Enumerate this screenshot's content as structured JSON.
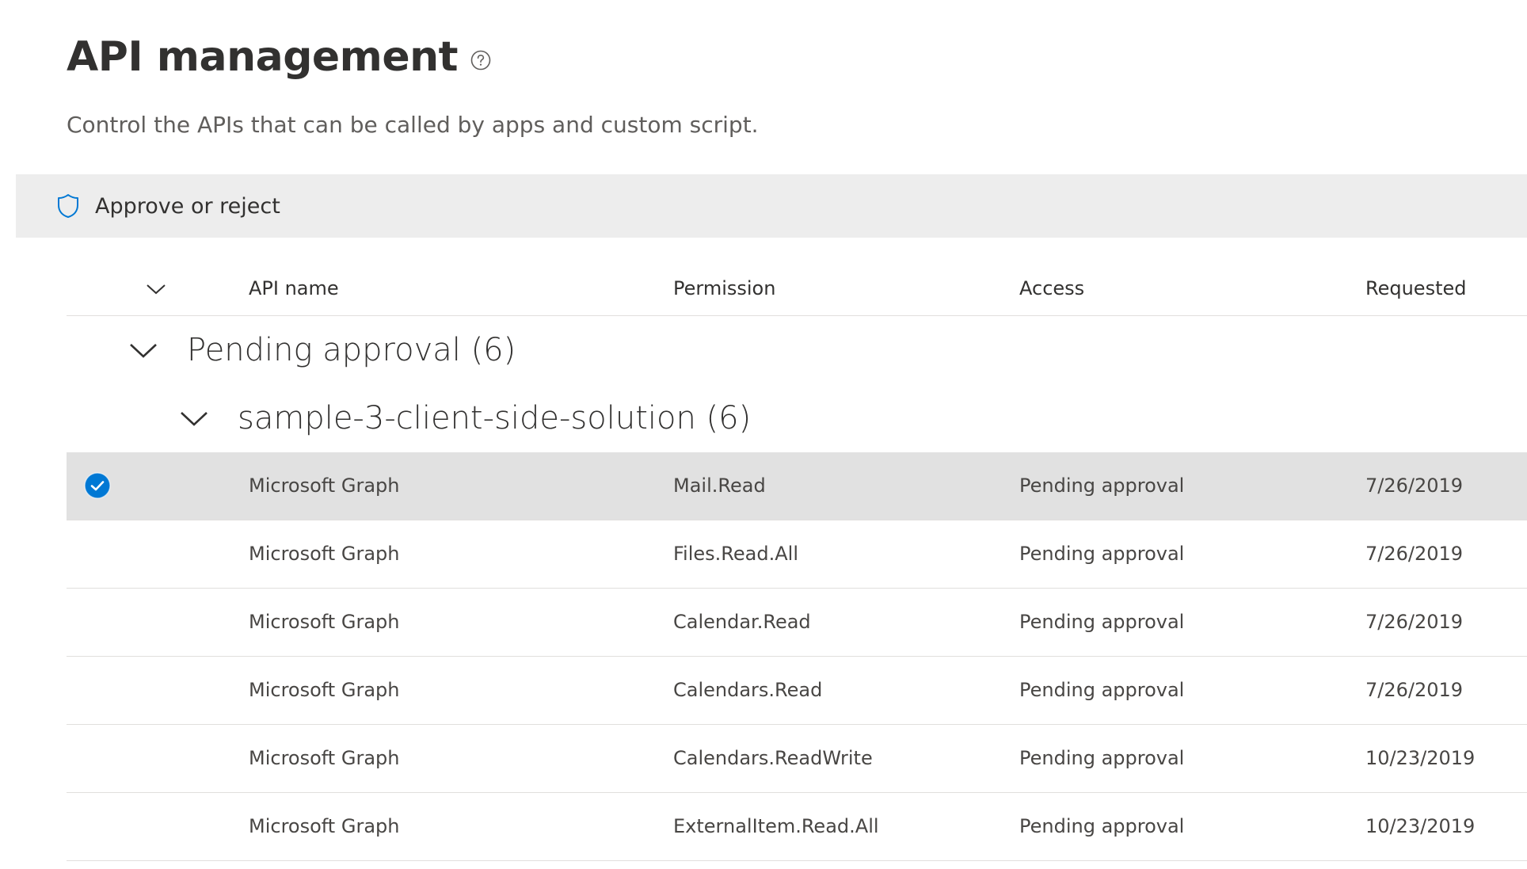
{
  "page": {
    "title": "API management",
    "subtitle": "Control the APIs that can be called by apps and custom script."
  },
  "command_bar": {
    "approve_label": "Approve or reject"
  },
  "table": {
    "columns": [
      "API name",
      "Permission",
      "Access",
      "Requested"
    ],
    "group": {
      "title": "Pending approval (6)",
      "subgroup": "sample-3-client-side-solution (6)"
    },
    "rows": [
      {
        "api": "Microsoft Graph",
        "permission": "Mail.Read",
        "access": "Pending approval",
        "requested": "7/26/2019",
        "selected": true
      },
      {
        "api": "Microsoft Graph",
        "permission": "Files.Read.All",
        "access": "Pending approval",
        "requested": "7/26/2019",
        "selected": false
      },
      {
        "api": "Microsoft Graph",
        "permission": "Calendar.Read",
        "access": "Pending approval",
        "requested": "7/26/2019",
        "selected": false
      },
      {
        "api": "Microsoft Graph",
        "permission": "Calendars.Read",
        "access": "Pending approval",
        "requested": "7/26/2019",
        "selected": false
      },
      {
        "api": "Microsoft Graph",
        "permission": "Calendars.ReadWrite",
        "access": "Pending approval",
        "requested": "10/23/2019",
        "selected": false
      },
      {
        "api": "Microsoft Graph",
        "permission": "ExternalItem.Read.All",
        "access": "Pending approval",
        "requested": "10/23/2019",
        "selected": false
      }
    ]
  },
  "icons": {
    "help": "help-circle-icon",
    "shield": "shield-icon",
    "chevron": "chevron-down-icon",
    "check": "checkmark-circle-icon"
  },
  "colors": {
    "accent": "#0078d4",
    "command_bar_bg": "#ededed",
    "selected_row_bg": "#e1e1e1"
  }
}
